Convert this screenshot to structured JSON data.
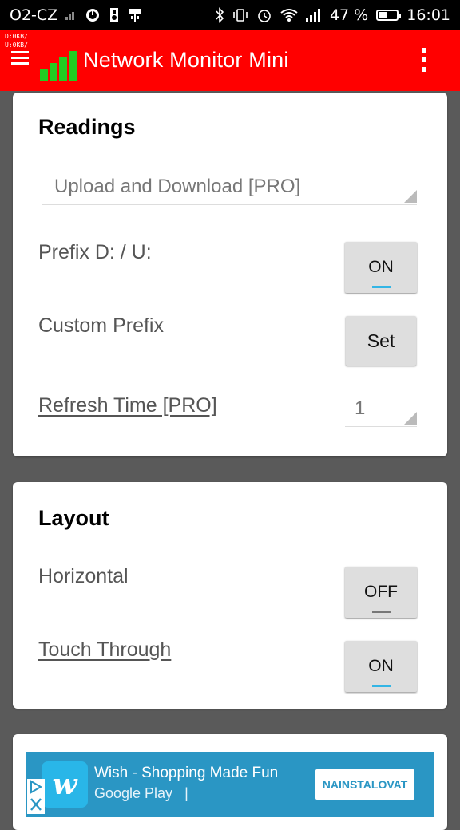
{
  "status_bar": {
    "carrier": "O2-CZ",
    "battery": "47 %",
    "time": "16:01",
    "icons": [
      "signal-icon",
      "power-icon",
      "sd-icon",
      "usb-icon",
      "bluetooth-icon",
      "vibrate-icon",
      "alarm-icon",
      "wifi-icon",
      "signal-bars-icon",
      "battery-icon"
    ]
  },
  "app_bar": {
    "mini_download": "D:0KB/",
    "mini_upload": "U:0KB/",
    "title": "Network Monitor Mini",
    "color": "#ff0000"
  },
  "readings": {
    "title": "Readings",
    "mode_select": "Upload and Download [PRO]",
    "prefix_label": "Prefix D: / U:",
    "prefix_toggle": "ON",
    "custom_prefix_label": "Custom Prefix",
    "custom_prefix_button": "Set",
    "refresh_label": "Refresh Time [PRO]",
    "refresh_value": "1"
  },
  "layout": {
    "title": "Layout",
    "horizontal_label": "Horizontal",
    "horizontal_toggle": "OFF",
    "touch_label": "Touch Through",
    "touch_toggle": "ON"
  },
  "ad": {
    "title": "Wish - Shopping Made Fun",
    "store": "Google Play",
    "separator": "|",
    "cta": "NAINSTALOVAT",
    "color": "#2a96c4"
  }
}
